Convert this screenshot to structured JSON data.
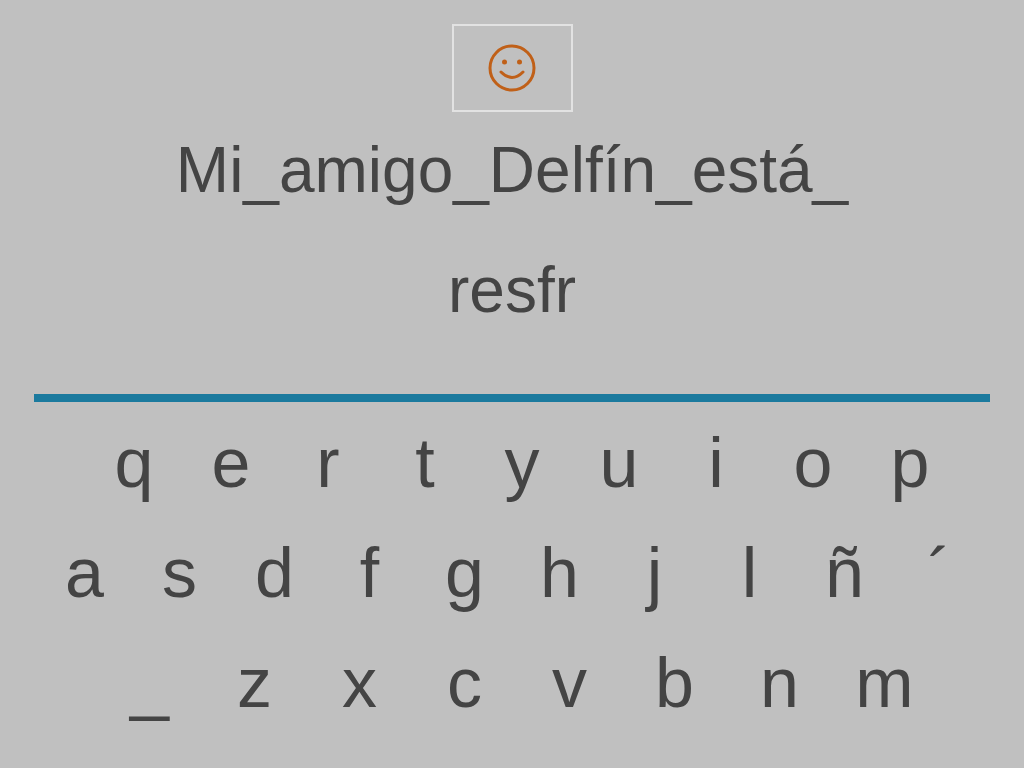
{
  "prompt": "Mi_amigo_Delfín_está_",
  "answer": "resfr",
  "keyboard": {
    "rows": [
      [
        "q",
        "e",
        "r",
        "t",
        "y",
        "u",
        "i",
        "o",
        "p"
      ],
      [
        "a",
        "s",
        "d",
        "f",
        "g",
        "h",
        "j",
        "l",
        "ñ",
        "´"
      ],
      [
        "_",
        "z",
        "x",
        "c",
        "v",
        "b",
        "n",
        "m"
      ]
    ]
  }
}
